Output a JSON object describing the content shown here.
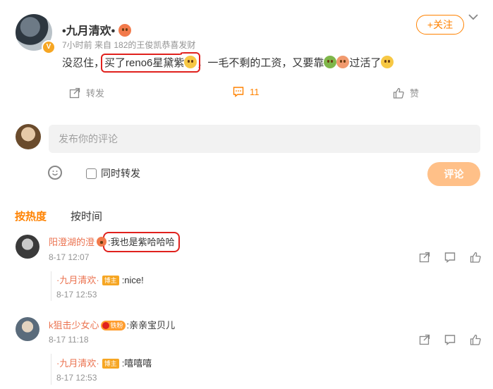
{
  "post": {
    "author": "•九月清欢•",
    "meta": "7小时前  来自 182的王俊凯恭喜发财",
    "text_before": "没忍住，",
    "text_highlight": "买了reno6星黛紫",
    "text_after": "，一毛不剩的工资，又要靠",
    "text_end": "过活了",
    "follow_label": "+关注",
    "repost_label": "转发",
    "comment_count": "11",
    "like_label": "赞"
  },
  "composer": {
    "placeholder": "发布你的评论",
    "also_repost_label": "同时转发",
    "submit_label": "评论"
  },
  "sort": {
    "hot": "按热度",
    "time": "按时间"
  },
  "comments": [
    {
      "name": "阳澄湖的澄",
      "text": ":我也是紫哈哈哈",
      "time": "8-17 12:07",
      "reply": {
        "name": "·九月清欢·",
        "badge": "博主",
        "text": ":nice!",
        "time": "8-17 12:53"
      }
    },
    {
      "name": "k狙击少女心",
      "fan_badge": "铁粉",
      "text": ":亲亲宝贝儿",
      "time": "8-17 11:18",
      "reply": {
        "name": "·九月清欢·",
        "badge": "博主",
        "text": ":嘻嘻嘻",
        "time": "8-17 12:53"
      }
    }
  ],
  "colors": {
    "accent": "#ff8200",
    "name_link": "#eb7350",
    "highlight_box": "#e0211d"
  }
}
